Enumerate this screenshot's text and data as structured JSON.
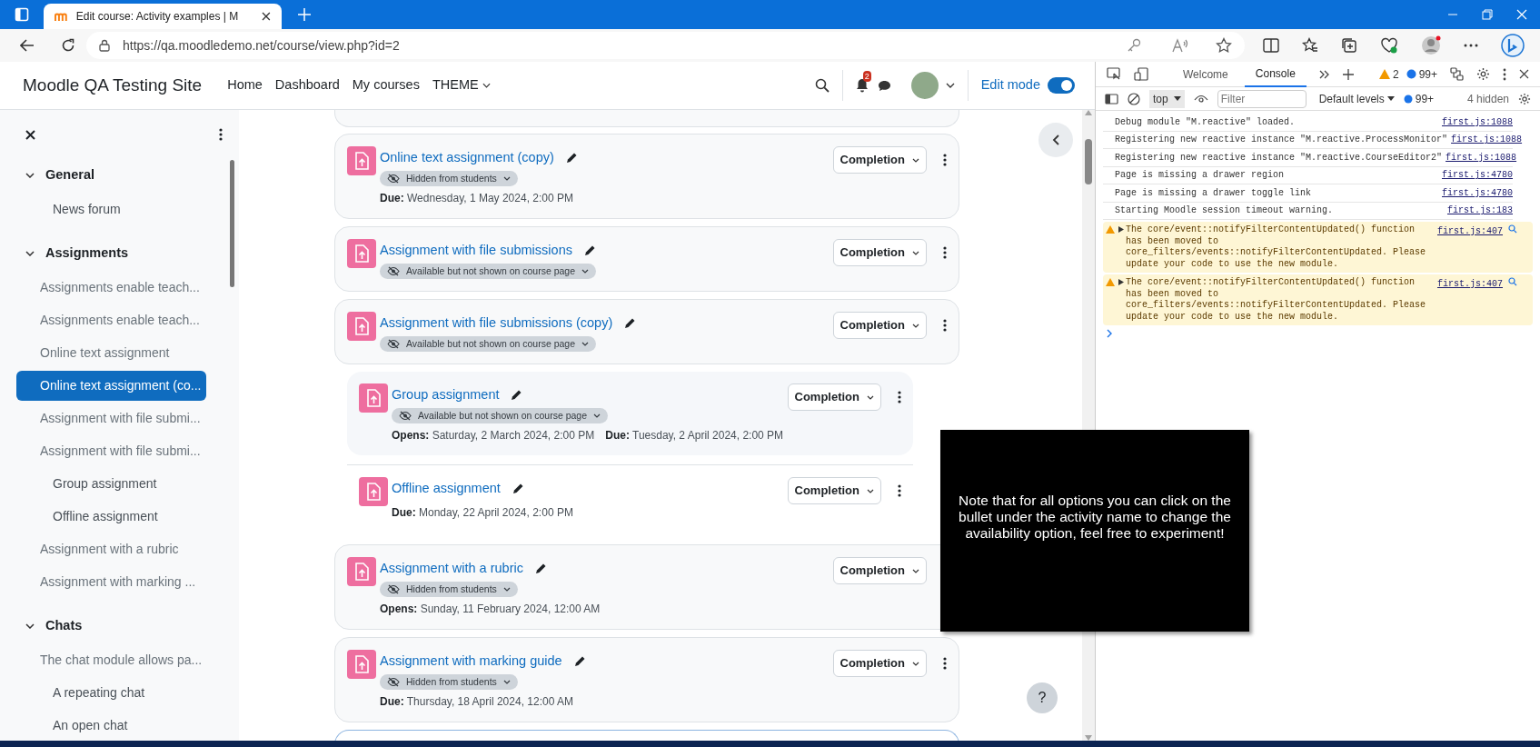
{
  "browser": {
    "tab_title": "Edit course: Activity examples | M",
    "url": "https://qa.moodledemo.net/course/view.php?id=2"
  },
  "navbar": {
    "site_name": "Moodle QA Testing Site",
    "links": [
      {
        "label": "Home",
        "dropdown": false
      },
      {
        "label": "Dashboard",
        "dropdown": false
      },
      {
        "label": "My courses",
        "dropdown": false
      },
      {
        "label": "THEME",
        "dropdown": true
      }
    ],
    "notification_count": "2",
    "edit_mode": {
      "label": "Edit mode",
      "on": true
    }
  },
  "sidebar": {
    "sections": [
      {
        "title": "General",
        "expanded": true,
        "items": [
          {
            "label": "News forum",
            "selected": false,
            "dimmed": false,
            "indented": true
          }
        ]
      },
      {
        "title": "Assignments",
        "expanded": true,
        "items": [
          {
            "label": "Assignments enable teach...",
            "selected": false,
            "dimmed": true,
            "indented": false
          },
          {
            "label": "Assignments enable teach...",
            "selected": false,
            "dimmed": true,
            "indented": false
          },
          {
            "label": "Online text assignment",
            "selected": false,
            "dimmed": true,
            "indented": false
          },
          {
            "label": "Online text assignment (co...",
            "selected": true,
            "dimmed": false,
            "indented": false
          },
          {
            "label": "Assignment with file submi...",
            "selected": false,
            "dimmed": true,
            "indented": false
          },
          {
            "label": "Assignment with file submi...",
            "selected": false,
            "dimmed": true,
            "indented": false
          },
          {
            "label": "Group assignment",
            "selected": false,
            "dimmed": false,
            "indented": true
          },
          {
            "label": "Offline assignment",
            "selected": false,
            "dimmed": false,
            "indented": true
          },
          {
            "label": "Assignment with a rubric",
            "selected": false,
            "dimmed": true,
            "indented": false
          },
          {
            "label": "Assignment with marking ...",
            "selected": false,
            "dimmed": true,
            "indented": false
          }
        ]
      },
      {
        "title": "Chats",
        "expanded": true,
        "items": [
          {
            "label": "The chat module allows pa...",
            "selected": false,
            "dimmed": true,
            "indented": false
          },
          {
            "label": "A repeating chat",
            "selected": false,
            "dimmed": false,
            "indented": true
          },
          {
            "label": "An open chat",
            "selected": false,
            "dimmed": false,
            "indented": true
          }
        ]
      }
    ]
  },
  "activities": [
    {
      "kind": "card",
      "name": "Online text assignment (copy)",
      "badge": "Hidden from students",
      "dates": [
        {
          "label": "Due:",
          "value": "Wednesday, 1 May 2024, 2:00 PM"
        }
      ],
      "completion": "Completion"
    },
    {
      "kind": "card",
      "name": "Assignment with file submissions",
      "badge": "Available but not shown on course page",
      "completion": "Completion"
    },
    {
      "kind": "card",
      "name": "Assignment with file submissions (copy)",
      "badge": "Available but not shown on course page",
      "completion": "Completion"
    },
    {
      "kind": "subcard",
      "name": "Group assignment",
      "badge": "Available but not shown on course page",
      "dates": [
        {
          "label": "Opens:",
          "value": "Saturday, 2 March 2024, 2:00 PM"
        },
        {
          "label": "Due:",
          "value": "Tuesday, 2 April 2024, 2:00 PM"
        }
      ],
      "completion": "Completion"
    },
    {
      "kind": "plain",
      "name": "Offline assignment",
      "dates": [
        {
          "label": "Due:",
          "value": "Monday, 22 April 2024, 2:00 PM"
        }
      ],
      "completion": "Completion"
    },
    {
      "kind": "card",
      "name": "Assignment with a rubric",
      "badge": "Hidden from students",
      "dates": [
        {
          "label": "Opens:",
          "value": "Sunday, 11 February 2024, 12:00 AM"
        }
      ],
      "completion": "Completion"
    },
    {
      "kind": "card",
      "name": "Assignment with marking guide",
      "badge": "Hidden from students",
      "dates": [
        {
          "label": "Due:",
          "value": "Thursday, 18 April 2024, 12:00 AM"
        }
      ],
      "completion": "Completion"
    }
  ],
  "tooltip": "Note that for all options you can click on the bullet under the activity name to change the availability option, feel free to experiment!",
  "help_button": "?",
  "devtools": {
    "tabs": [
      {
        "label": "Welcome",
        "selected": false
      },
      {
        "label": "Console",
        "selected": true
      }
    ],
    "warning_count": "2",
    "info_count": "99+",
    "context": "top",
    "filter_placeholder": "Filter",
    "levels": "Default levels",
    "message_count": "99+",
    "hidden": "4 hidden",
    "messages": [
      {
        "kind": "log",
        "text": "Debug module \"M.reactive\" loaded.",
        "source": "first.js:1088"
      },
      {
        "kind": "log",
        "text": "Registering new reactive instance \"M.reactive.ProcessMonitor\"",
        "source": "first.js:1088"
      },
      {
        "kind": "log",
        "text": "Registering new reactive instance \"M.reactive.CourseEditor2\"",
        "source": "first.js:1088"
      },
      {
        "kind": "log",
        "text": "Page is missing a drawer region",
        "source": "first.js:4780"
      },
      {
        "kind": "log",
        "text": "Page is missing a drawer toggle link",
        "source": "first.js:4780"
      },
      {
        "kind": "log",
        "text": "Starting Moodle session timeout warning.",
        "source": "first.js:183"
      },
      {
        "kind": "warning",
        "text": "The core/event::notifyFilterContentUpdated() function has been moved to core_filters/events::notifyFilterContentUpdated. Please update your code to use the new module.",
        "source": "first.js:407"
      },
      {
        "kind": "warning",
        "text": "The core/event::notifyFilterContentUpdated() function has been moved to core_filters/events::notifyFilterContentUpdated. Please update your code to use the new module.",
        "source": "first.js:407"
      }
    ]
  }
}
